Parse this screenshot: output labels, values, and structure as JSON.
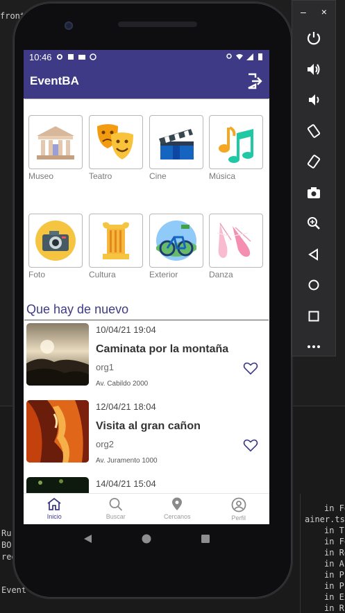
{
  "ide": {
    "line1": "fronte",
    "right_lines": [
      "in Fo",
      "ainer.tsx",
      "in Th",
      "in Fo",
      "in Re",
      "in Au",
      "in Pr",
      "in Pr",
      "in Ex",
      "in R"
    ],
    "left_lines": [
      "Ru",
      "BO",
      "req",
      "Event"
    ]
  },
  "status_bar": {
    "time": "10:46"
  },
  "app_bar": {
    "title": "EventBA",
    "logout_icon": "logout-icon"
  },
  "categories": [
    {
      "label": "Museo",
      "icon": "museum-icon"
    },
    {
      "label": "Teatro",
      "icon": "theater-masks-icon"
    },
    {
      "label": "Cine",
      "icon": "clapperboard-icon"
    },
    {
      "label": "Música",
      "icon": "music-notes-icon"
    },
    {
      "label": "Foto",
      "icon": "camera-icon"
    },
    {
      "label": "Cultura",
      "icon": "column-icon"
    },
    {
      "label": "Exterior",
      "icon": "bicycle-icon"
    },
    {
      "label": "Danza",
      "icon": "ballet-shoes-icon"
    }
  ],
  "section": {
    "title": "Que hay de nuevo"
  },
  "events": [
    {
      "date": "10/04/21 19:04",
      "name": "Caminata por la montaña",
      "org": "org1",
      "address": "Av. Cabildo 2000"
    },
    {
      "date": "12/04/21 18:04",
      "name": "Visita al gran cañon",
      "org": "org2",
      "address": "Av. Juramento 1000"
    },
    {
      "date": "14/04/21 15:04",
      "name": "",
      "org": "",
      "address": ""
    }
  ],
  "bottom_nav": [
    {
      "label": "Inicio",
      "icon": "home-icon",
      "active": true
    },
    {
      "label": "Buscar",
      "icon": "search-icon",
      "active": false
    },
    {
      "label": "Cercanos",
      "icon": "location-pin-icon",
      "active": false
    },
    {
      "label": "Perfil",
      "icon": "profile-icon",
      "active": false
    }
  ],
  "colors": {
    "primary": "#3e3a86",
    "background": "#ffffff"
  },
  "emulator": {
    "minimize": "–",
    "close": "×",
    "tools": [
      "power-icon",
      "volume-up-icon",
      "volume-down-icon",
      "rotate-left-icon",
      "rotate-right-icon",
      "screenshot-icon",
      "zoom-icon",
      "back-icon",
      "home-circle-icon",
      "overview-icon",
      "more-icon"
    ]
  }
}
